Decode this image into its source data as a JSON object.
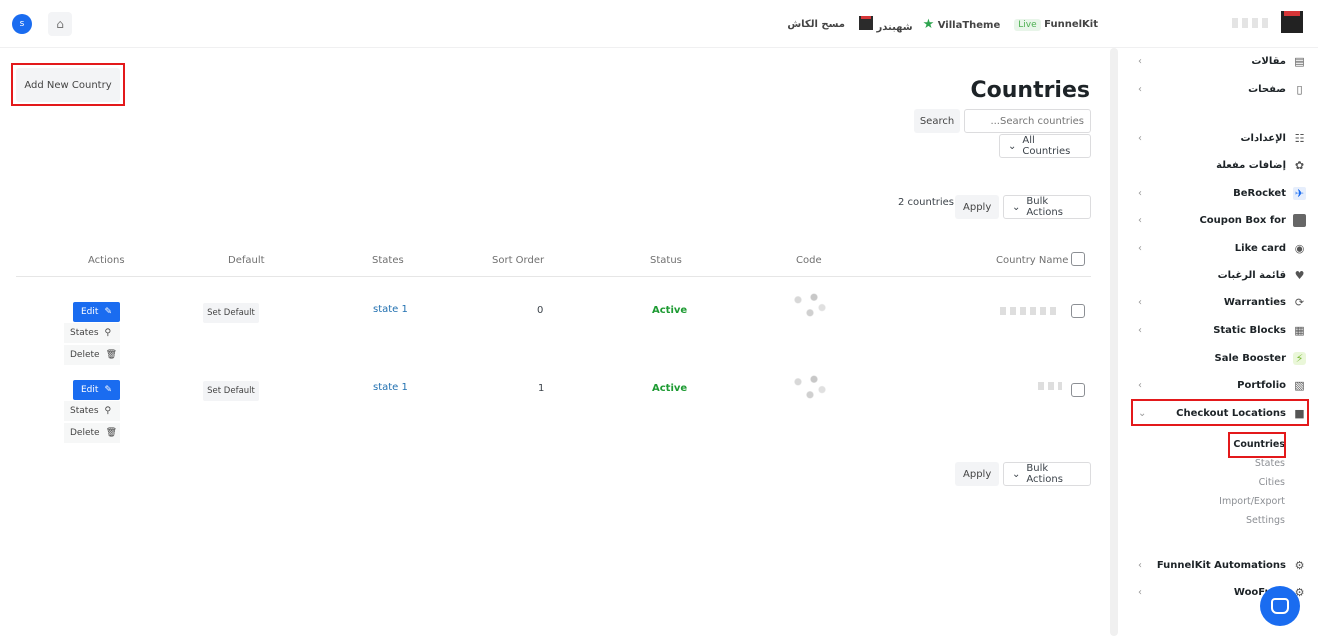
{
  "topbar": {
    "avatar": "s",
    "home_icon": "home-icon",
    "live": "Live",
    "funnelkit": "FunnelKit",
    "villatheme": "VillaTheme",
    "shahbandar": "شهبندر",
    "clear_cache": "مسح الكاش"
  },
  "page": {
    "add_new": "Add New Country",
    "title": "Countries",
    "search_placeholder": "...Search countries",
    "search_btn": "Search",
    "filter": "All Countries",
    "bulk_actions": "Bulk Actions",
    "apply": "Apply",
    "count": "2 countries"
  },
  "table": {
    "headers": {
      "name": "Country Name",
      "code": "Code",
      "status": "Status",
      "sort": "Sort Order",
      "states": "States",
      "default": "Default",
      "actions": "Actions"
    },
    "rows": [
      {
        "states": "state 1",
        "sort": "0",
        "status": "Active",
        "set_default": "Set Default",
        "edit": "Edit",
        "states_btn": "States",
        "delete": "Delete"
      },
      {
        "states": "state 1",
        "sort": "1",
        "status": "Active",
        "set_default": "Set Default",
        "edit": "Edit",
        "states_btn": "States",
        "delete": "Delete"
      }
    ]
  },
  "sidebar": {
    "items": [
      {
        "label": "مقالات"
      },
      {
        "label": "صفحات"
      },
      {
        "label": "الإعدادات"
      },
      {
        "label": "إضافات مفعلة"
      },
      {
        "label": "BeRocket"
      },
      {
        "label": "Coupon Box for"
      },
      {
        "label": "Like card"
      },
      {
        "label": "قائمة الرغبات"
      },
      {
        "label": "Warranties"
      },
      {
        "label": "Static Blocks"
      },
      {
        "label": "Sale Booster"
      },
      {
        "label": "Portfolio"
      },
      {
        "label": "Checkout Locations"
      },
      {
        "label": "FunnelKit Automations"
      },
      {
        "label": "WooFunn"
      }
    ],
    "submenu": [
      "Countries",
      "States",
      "Cities",
      "Import/Export",
      "Settings"
    ]
  },
  "colors": {
    "primary": "#1a6cf0",
    "active_green": "#1e9b33",
    "highlight_red": "#e3191b"
  }
}
